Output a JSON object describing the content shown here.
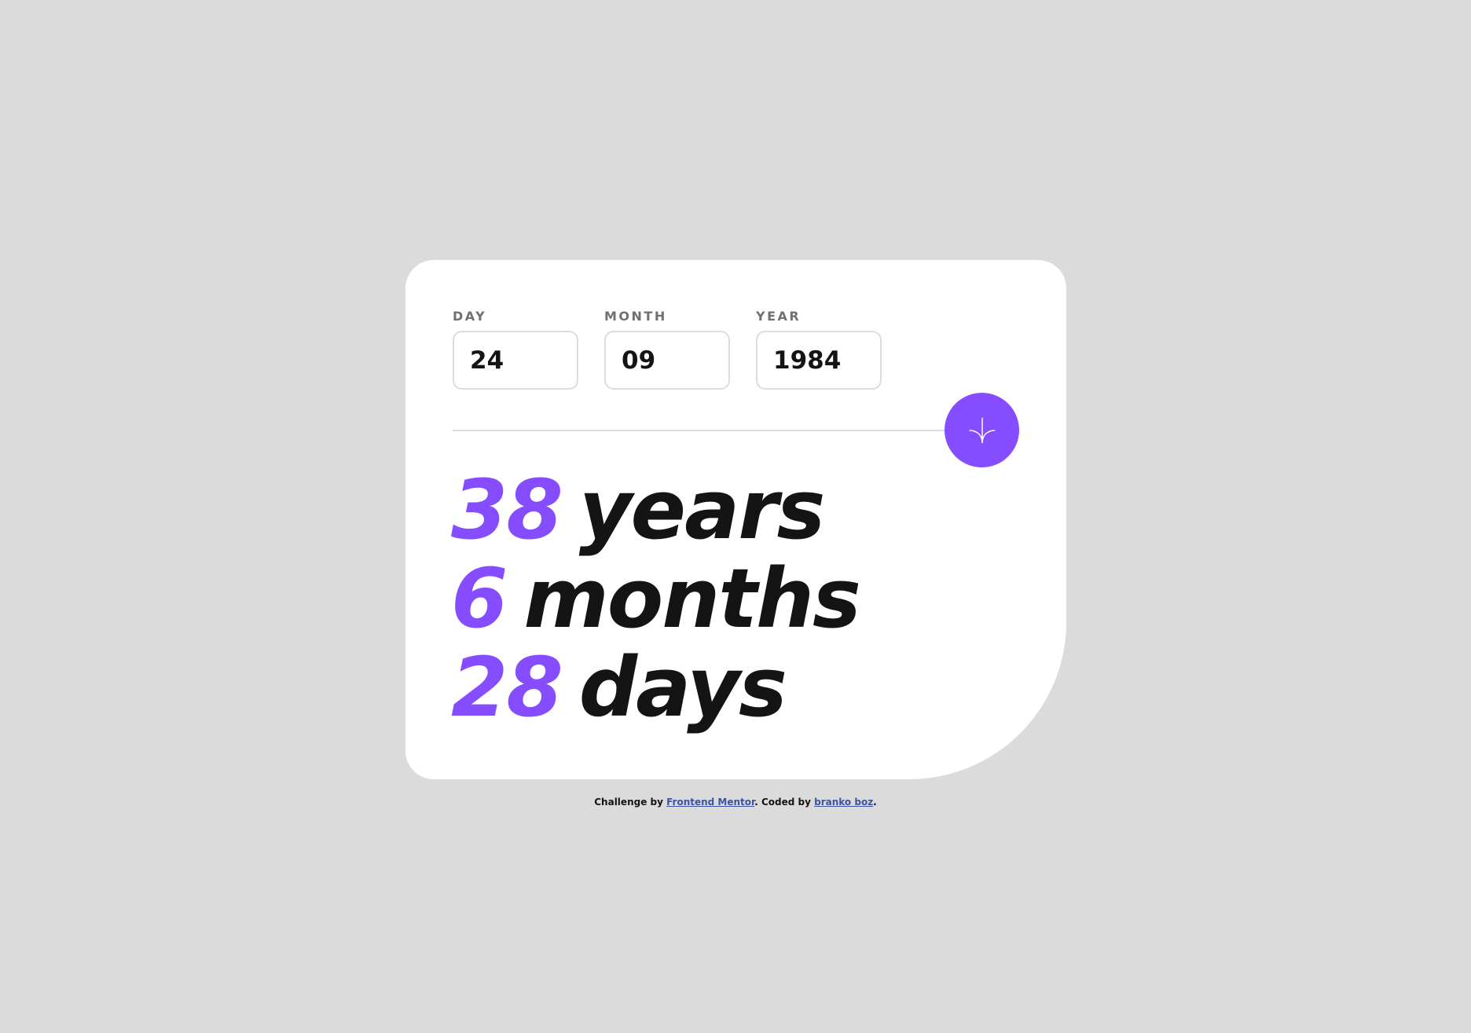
{
  "colors": {
    "background": "#dbdbdb",
    "card": "#ffffff",
    "accent": "#854dff",
    "text": "#141414",
    "label": "#716f6f",
    "link": "#3e52a3"
  },
  "form": {
    "day": {
      "label": "DAY",
      "value": "24"
    },
    "month": {
      "label": "MONTH",
      "value": "09"
    },
    "year": {
      "label": "YEAR",
      "value": "1984"
    },
    "submit_icon": "arrow-down-icon"
  },
  "results": {
    "years": {
      "value": "38",
      "unit": "years"
    },
    "months": {
      "value": "6",
      "unit": "months"
    },
    "days": {
      "value": "28",
      "unit": "days"
    }
  },
  "attribution": {
    "prefix": "Challenge by ",
    "link1": "Frontend Mentor",
    "middle": ". Coded by ",
    "link2": "branko boz",
    "suffix": "."
  }
}
